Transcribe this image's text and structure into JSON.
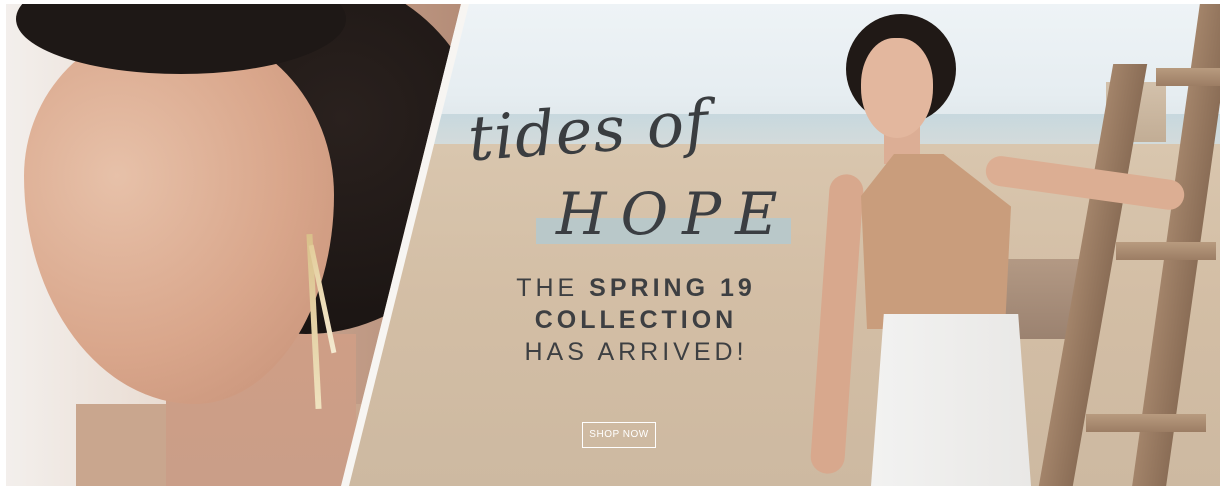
{
  "hero": {
    "script_title": "tides of",
    "main_title": "HOPE",
    "tagline": {
      "line1_a": "THE ",
      "line1_b": "SPRING 19",
      "line2": "COLLECTION",
      "line3": "HAS ARRIVED!"
    },
    "cta_label": "SHOP NOW"
  },
  "colors": {
    "accent_band": "#b9c8c9",
    "headline": "#3b3e42",
    "button_border": "#ffffff"
  }
}
